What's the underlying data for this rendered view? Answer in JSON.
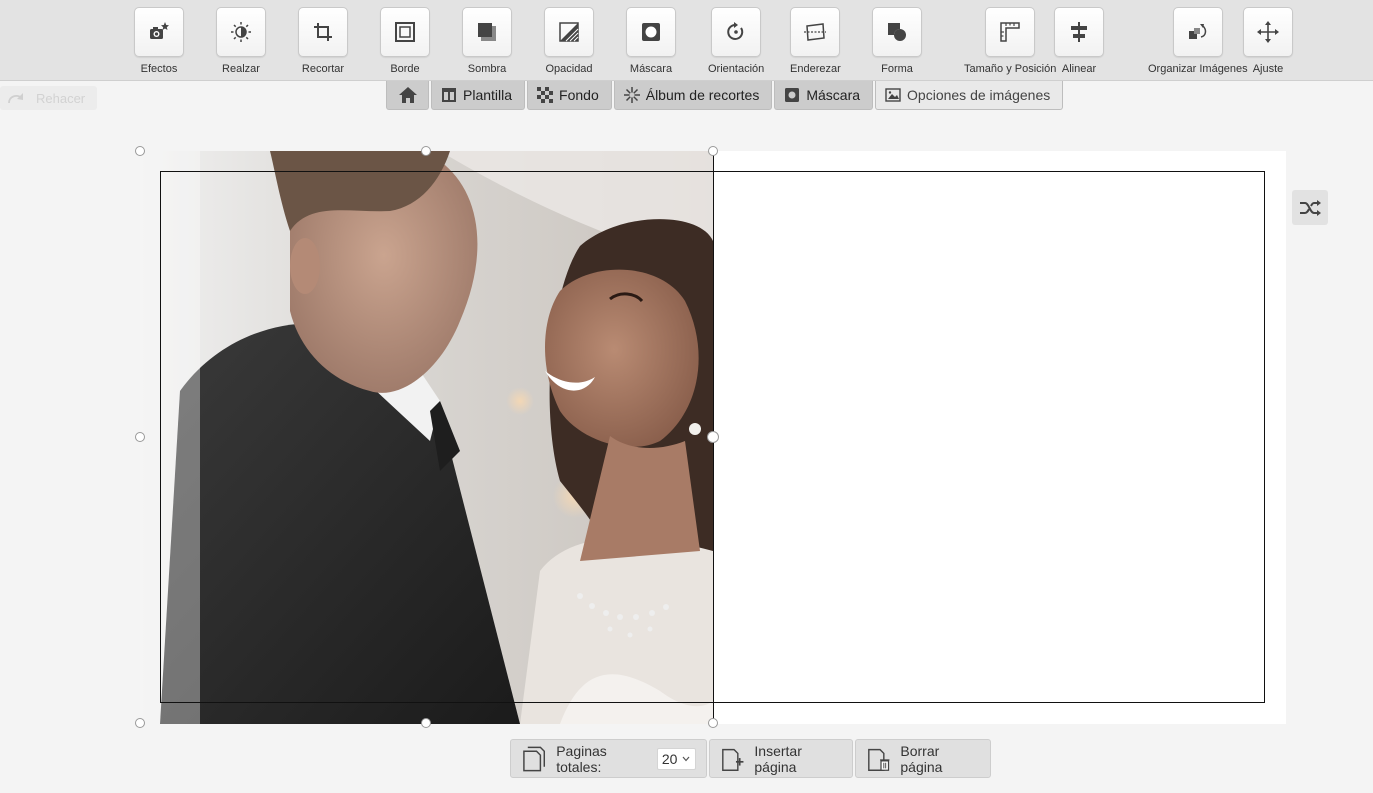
{
  "toolbar": {
    "tools": [
      {
        "label": "Efectos",
        "icon": "camera-star-icon"
      },
      {
        "label": "Realzar",
        "icon": "brightness-icon"
      },
      {
        "label": "Recortar",
        "icon": "crop-icon"
      },
      {
        "label": "Borde",
        "icon": "border-icon"
      },
      {
        "label": "Sombra",
        "icon": "shadow-icon"
      },
      {
        "label": "Opacidad",
        "icon": "opacity-icon"
      },
      {
        "label": "Máscara",
        "icon": "mask-icon"
      },
      {
        "label": "Orientación",
        "icon": "rotate-icon"
      },
      {
        "label": "Enderezar",
        "icon": "straighten-icon"
      },
      {
        "label": "Forma",
        "icon": "shape-icon"
      },
      {
        "label": "Tamaño y Posición",
        "icon": "ruler-icon"
      },
      {
        "label": "Alinear",
        "icon": "align-icon"
      },
      {
        "label": "Organizar Imágenes",
        "icon": "arrange-icon"
      },
      {
        "label": "Ajuste",
        "icon": "move-icon"
      }
    ]
  },
  "redo": {
    "label": "Rehacer"
  },
  "tabs": [
    {
      "label": "",
      "icon": "home-icon"
    },
    {
      "label": "Plantilla",
      "icon": "template-icon"
    },
    {
      "label": "Fondo",
      "icon": "checkerboard-icon"
    },
    {
      "label": "Álbum de recortes",
      "icon": "sparkle-icon"
    },
    {
      "label": "Máscara",
      "icon": "mask-icon"
    },
    {
      "label": "Opciones de imágenes",
      "icon": "image-icon",
      "active": true
    }
  ],
  "canvas": {
    "photo": {
      "description_icon": "wedding-photo"
    }
  },
  "shuffle": {
    "icon": "shuffle-icon"
  },
  "pages": {
    "total_label": "Paginas totales:",
    "total_value": "20",
    "insert_label": "Insertar página",
    "delete_label": "Borrar página"
  }
}
